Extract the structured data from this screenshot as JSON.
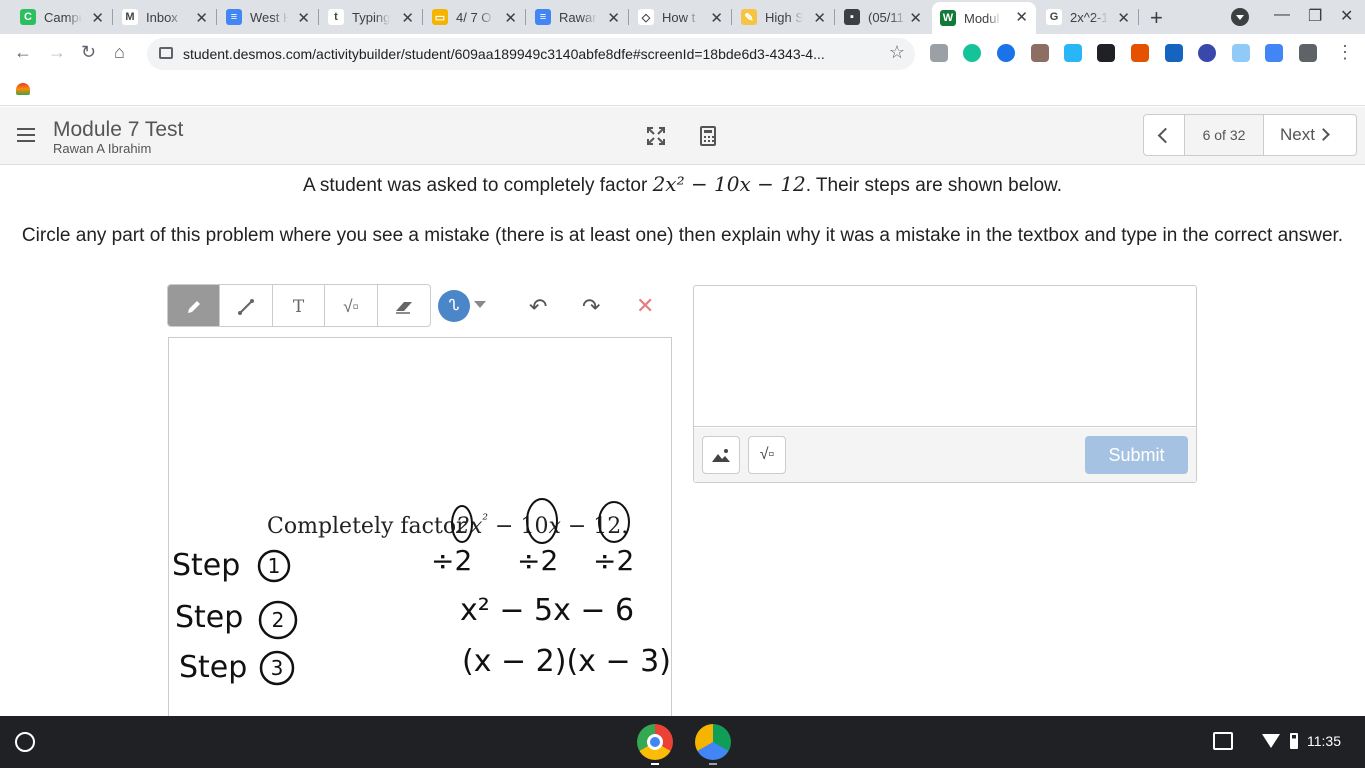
{
  "browser": {
    "tabs": [
      {
        "title": "Campus",
        "fav_color": "#2dbe60",
        "fav_glyph": "C"
      },
      {
        "title": "Inbox",
        "fav_color": "#ffffff",
        "fav_glyph": "M"
      },
      {
        "title": "West H",
        "fav_color": "#4285f4",
        "fav_glyph": "≡"
      },
      {
        "title": "Typing",
        "fav_color": "#ffffff",
        "fav_glyph": "t"
      },
      {
        "title": "4/ 7 O",
        "fav_color": "#f4b400",
        "fav_glyph": "▭"
      },
      {
        "title": "Rawan",
        "fav_color": "#4285f4",
        "fav_glyph": "≡"
      },
      {
        "title": "How t",
        "fav_color": "#ffffff",
        "fav_glyph": "◇"
      },
      {
        "title": "High S",
        "fav_color": "#f6c342",
        "fav_glyph": "✎"
      },
      {
        "title": "(05/11",
        "fav_color": "#3c4043",
        "fav_glyph": "▪"
      },
      {
        "title": "Modul",
        "fav_color": "#127a38",
        "fav_glyph": "W"
      },
      {
        "title": "2x^2-1",
        "fav_color": "#ffffff",
        "fav_glyph": "G"
      }
    ],
    "new_tab_label": "+",
    "url": "student.desmos.com/activitybuilder/student/609aa189949c3140abfe8dfe#screenId=18bde6d3-4343-4..."
  },
  "header": {
    "title": "Module 7 Test",
    "student": "Rawan A Ibrahim",
    "page_count": "6 of 32",
    "next_label": "Next"
  },
  "prompt": {
    "line1_before": "A student was asked to completely factor",
    "line1_math": "2x² − 10x − 12",
    "line1_after": ". Their steps are shown below.",
    "line2": "Circle any part of this problem where you see a mistake (there is at least one) then explain why it was a mistake in the textbox and type in the correct answer."
  },
  "sketch": {
    "tools": [
      "pencil",
      "line",
      "T",
      "√",
      "eraser"
    ],
    "color": "#4a86c8",
    "printed_title": "Completely factor",
    "printed_expr": [
      "2x",
      "²",
      " − ",
      "10",
      "x − ",
      "12",
      "."
    ],
    "handwriting": {
      "step_label": "Step",
      "steps": [
        "1",
        "2",
        "3"
      ],
      "divide_marks": [
        "÷2",
        "÷2",
        "÷2"
      ],
      "step2": "x² − 5x − 6",
      "step3": "(x − 2)(x − 3)"
    }
  },
  "answer": {
    "text": "",
    "submit_label": "Submit"
  },
  "shelf": {
    "time": "11:35"
  }
}
